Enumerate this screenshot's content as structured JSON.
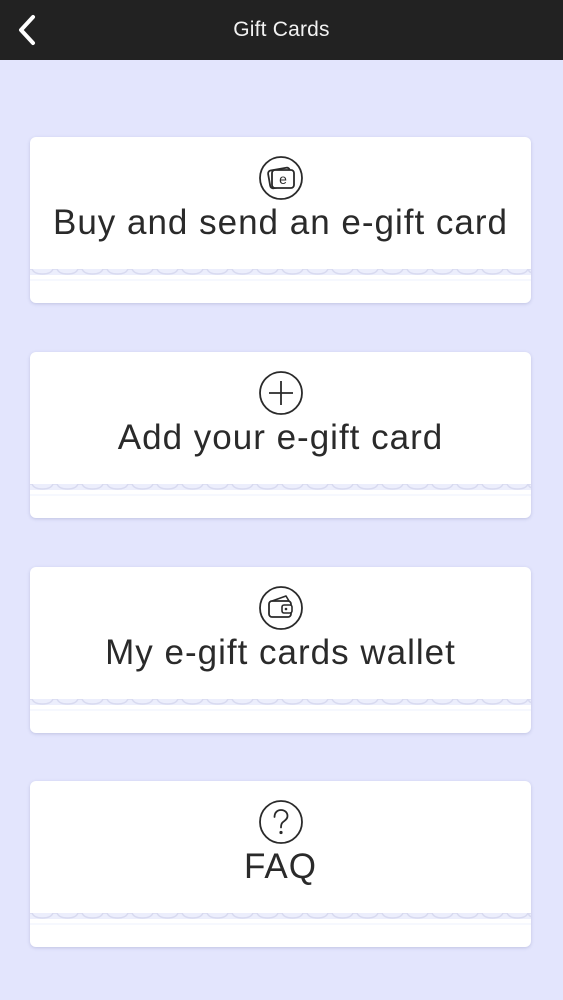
{
  "header": {
    "title": "Gift Cards",
    "back_icon": "chevron-left-icon"
  },
  "cards": [
    {
      "label": "Buy and send an e-gift card",
      "icon": "e-card-icon"
    },
    {
      "label": "Add your e-gift card",
      "icon": "plus-circle-icon"
    },
    {
      "label": "My e-gift cards wallet",
      "icon": "wallet-icon"
    },
    {
      "label": "FAQ",
      "icon": "question-circle-icon"
    }
  ],
  "colors": {
    "background": "#e3e5fd",
    "header": "#222222",
    "card": "#ffffff",
    "text": "#2a2a2a",
    "perforation": "#d8daf0"
  }
}
